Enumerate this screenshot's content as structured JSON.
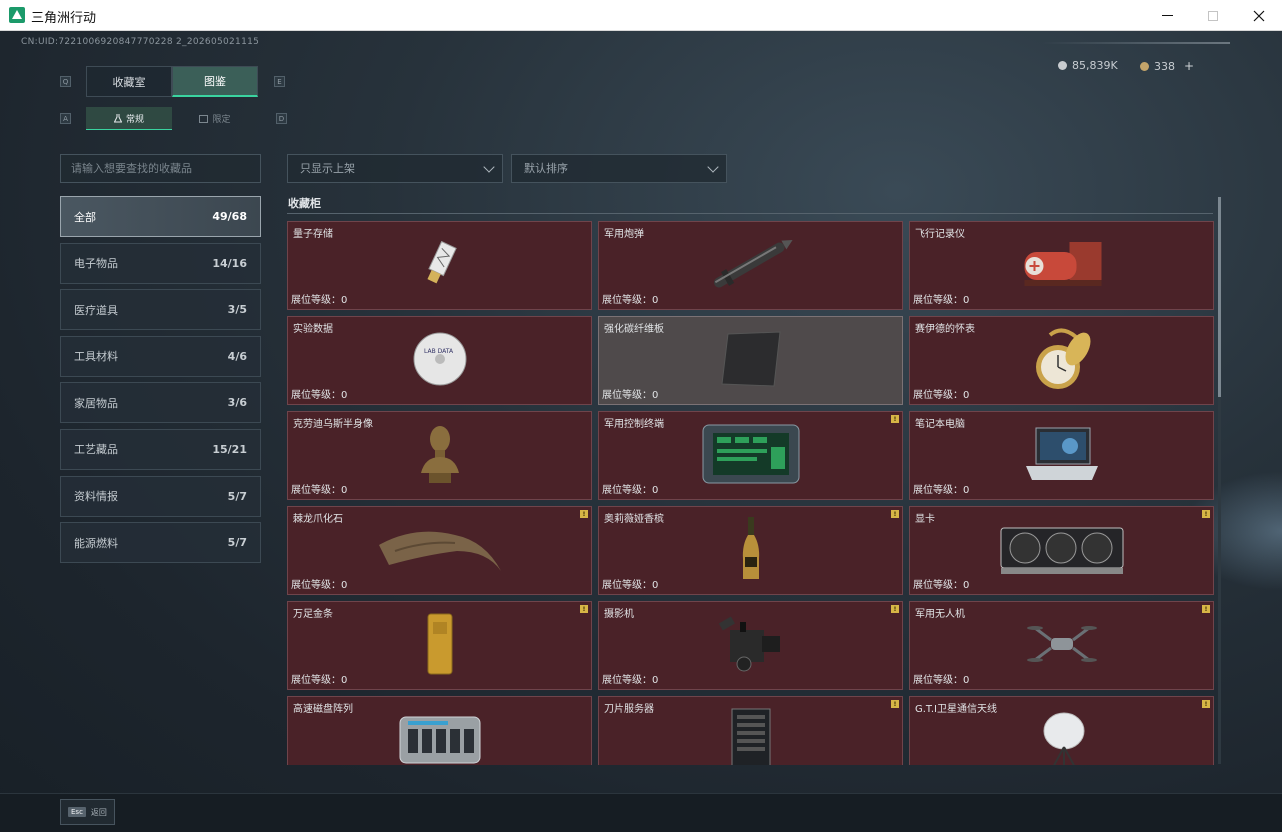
{
  "window": {
    "title": "三角洲行动",
    "min_icon": "minimize-icon",
    "max_icon": "maximize-icon",
    "close_icon": "close-icon"
  },
  "header": {
    "uid": "CN:UID:7221006920847770228 2_202605021115",
    "currency1": "85,839K",
    "currency2": "338",
    "plus": "+"
  },
  "keys": {
    "q": "Q",
    "e": "E",
    "a": "A",
    "d": "D"
  },
  "tabs": [
    {
      "label": "收藏室",
      "active": false
    },
    {
      "label": "图鉴",
      "active": true
    }
  ],
  "subtabs": [
    {
      "label": "常规",
      "icon": "flask-icon",
      "active": true
    },
    {
      "label": "限定",
      "icon": "box-icon",
      "active": false
    }
  ],
  "search": {
    "placeholder": "请输入想要查找的收藏品"
  },
  "filters": {
    "filter1": "只显示上架",
    "filter2": "默认排序"
  },
  "categories": [
    {
      "label": "全部",
      "count": "49/68",
      "active": true
    },
    {
      "label": "电子物品",
      "count": "14/16"
    },
    {
      "label": "医疗道具",
      "count": "3/5"
    },
    {
      "label": "工具材料",
      "count": "4/6"
    },
    {
      "label": "家居物品",
      "count": "3/6"
    },
    {
      "label": "工艺藏品",
      "count": "15/21"
    },
    {
      "label": "资料情报",
      "count": "5/7"
    },
    {
      "label": "能源燃料",
      "count": "5/7"
    }
  ],
  "section": {
    "title": "收藏柜"
  },
  "items": [
    {
      "name": "量子存储",
      "level": "展位等级：0",
      "badge": false,
      "art": "usb"
    },
    {
      "name": "军用炮弹",
      "level": "展位等级：0",
      "badge": false,
      "art": "shell"
    },
    {
      "name": "飞行记录仪",
      "level": "展位等级：0",
      "badge": false,
      "art": "recorder"
    },
    {
      "name": "实验数据",
      "level": "展位等级：0",
      "badge": false,
      "art": "disc"
    },
    {
      "name": "强化碳纤维板",
      "level": "展位等级：0",
      "badge": false,
      "art": "plate",
      "gray": true
    },
    {
      "name": "赛伊德的怀表",
      "level": "展位等级：0",
      "badge": false,
      "art": "watch"
    },
    {
      "name": "克劳迪乌斯半身像",
      "level": "展位等级：0",
      "badge": false,
      "art": "bust"
    },
    {
      "name": "军用控制终端",
      "level": "展位等级：0",
      "badge": true,
      "art": "terminal"
    },
    {
      "name": "笔记本电脑",
      "level": "展位等级：0",
      "badge": false,
      "art": "laptop"
    },
    {
      "name": "棘龙爪化石",
      "level": "展位等级：0",
      "badge": true,
      "art": "claw"
    },
    {
      "name": "奥莉薇娅香槟",
      "level": "展位等级：0",
      "badge": true,
      "art": "bottle"
    },
    {
      "name": "显卡",
      "level": "展位等级：0",
      "badge": true,
      "art": "gpu"
    },
    {
      "name": "万足金条",
      "level": "展位等级：0",
      "badge": true,
      "art": "gold"
    },
    {
      "name": "摄影机",
      "level": "展位等级：0",
      "badge": true,
      "art": "camera"
    },
    {
      "name": "军用无人机",
      "level": "展位等级：0",
      "badge": true,
      "art": "drone"
    },
    {
      "name": "高速磁盘阵列",
      "level": "",
      "badge": false,
      "art": "raid"
    },
    {
      "name": "刀片服务器",
      "level": "",
      "badge": true,
      "art": "server"
    },
    {
      "name": "G.T.I卫星通信天线",
      "level": "",
      "badge": true,
      "art": "dish"
    }
  ],
  "badge_text": "!",
  "footer": {
    "esc_key": "Esc",
    "esc_label": "返回"
  }
}
